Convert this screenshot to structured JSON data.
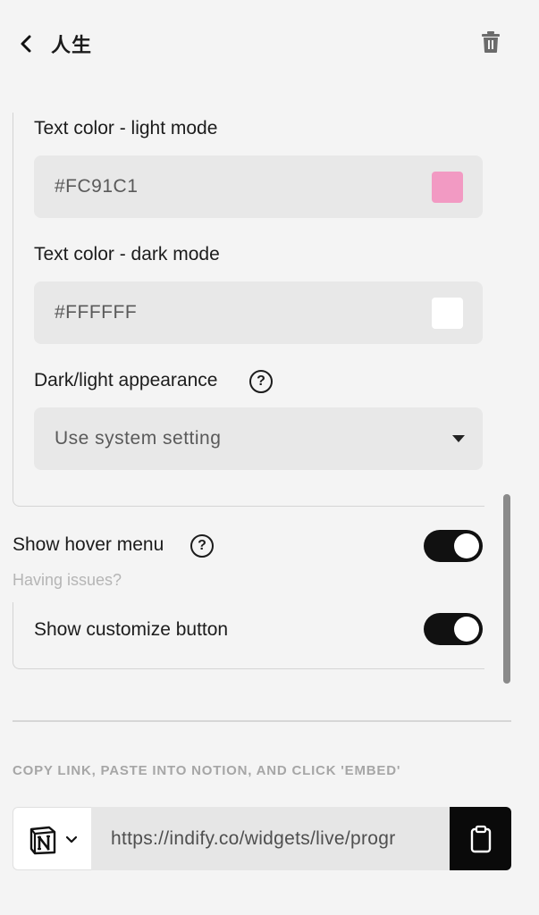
{
  "header": {
    "title": "人生"
  },
  "fields": {
    "text_color_light": {
      "label": "Text color - light mode",
      "value": "#FC91C1",
      "swatch": "#F29AC3"
    },
    "text_color_dark": {
      "label": "Text color - dark mode",
      "value": "#FFFFFF",
      "swatch": "#FFFFFF"
    },
    "appearance": {
      "label": "Dark/light appearance",
      "value": "Use system setting"
    }
  },
  "hover_menu": {
    "label": "Show hover menu",
    "enabled": true,
    "hint": "Having issues?"
  },
  "customize_button": {
    "label": "Show customize button",
    "enabled": true
  },
  "embed": {
    "heading": "COPY LINK, PASTE INTO NOTION, AND CLICK 'EMBED'",
    "platform_icon": "notion-icon",
    "url": "https://indify.co/widgets/live/progr"
  },
  "icons": {
    "back": "chevron-left-icon",
    "trash": "trash-icon",
    "help": "question-circle-icon",
    "copy": "clipboard-icon"
  },
  "help_glyph": "?"
}
